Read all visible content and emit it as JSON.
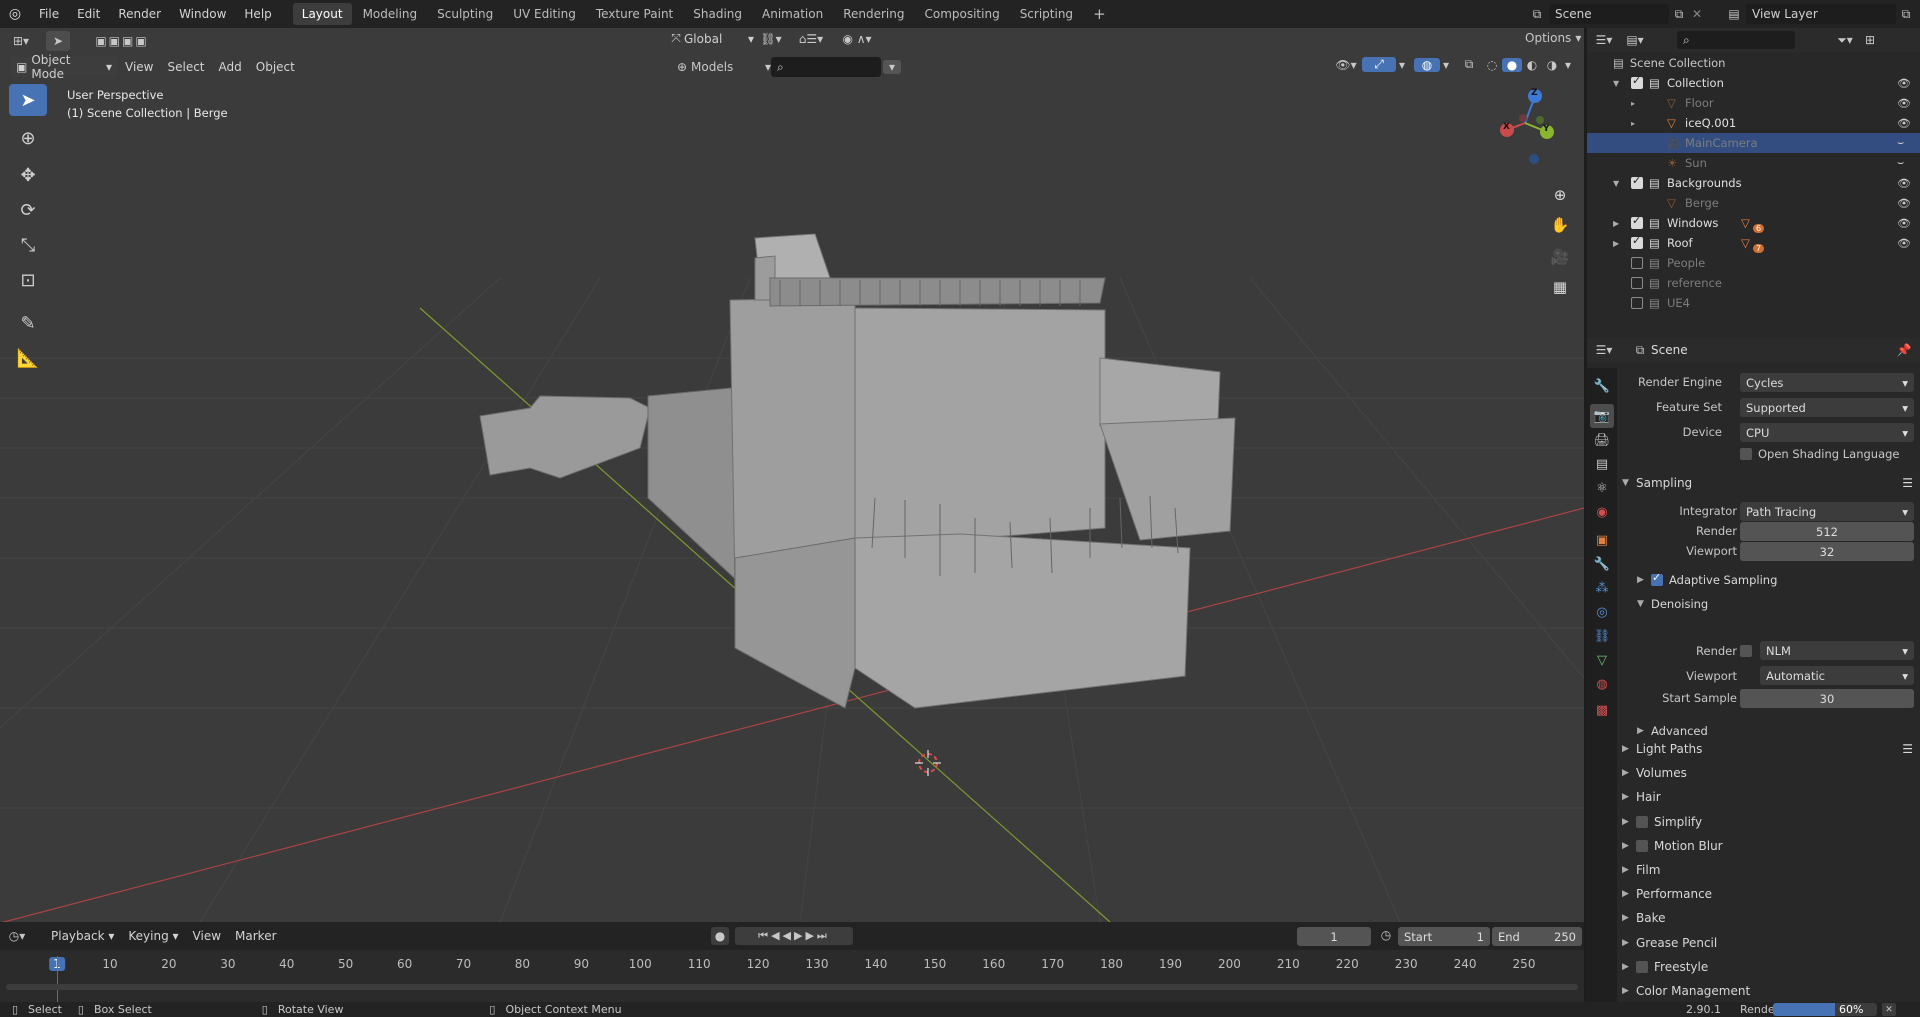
{
  "topbar": {
    "menus": [
      "File",
      "Edit",
      "Render",
      "Window",
      "Help"
    ],
    "workspaces": [
      "Layout",
      "Modeling",
      "Sculpting",
      "UV Editing",
      "Texture Paint",
      "Shading",
      "Animation",
      "Rendering",
      "Compositing",
      "Scripting"
    ],
    "add_tab": "+",
    "scene_name": "Scene",
    "view_layer": "View Layer"
  },
  "viewport": {
    "mode": "Object Mode",
    "menus": [
      "View",
      "Select",
      "Add",
      "Object"
    ],
    "transform_orientation": "Global",
    "collection_filter": "Models",
    "options": "Options",
    "overlay_title": "User Perspective",
    "overlay_subtitle": "(1) Scene Collection | Berge",
    "gizmo": {
      "x": "X",
      "y": "Y",
      "z": "Z"
    },
    "colors": {
      "bg": "#3d3d3d",
      "x_axis": "#c94a4a",
      "y_axis": "#8ab52e",
      "active_tool": "#4772b3"
    }
  },
  "timeline": {
    "menus": [
      "Playback",
      "Keying",
      "View",
      "Marker"
    ],
    "current_frame": "1",
    "start_label": "Start",
    "start": "1",
    "end_label": "End",
    "end": "250",
    "ticks": [
      "1",
      "10",
      "20",
      "30",
      "40",
      "50",
      "60",
      "70",
      "80",
      "90",
      "100",
      "110",
      "120",
      "130",
      "140",
      "150",
      "160",
      "170",
      "180",
      "190",
      "200",
      "210",
      "220",
      "230",
      "240",
      "250"
    ]
  },
  "statusbar": {
    "select": "Select",
    "box_select": "Box Select",
    "rotate_view": "Rotate View",
    "context_menu": "Object Context Menu",
    "version": "2.90.1",
    "render_label": "Render",
    "render_progress": "60%",
    "render_progress_value": 0.6
  },
  "outliner": {
    "root": "Scene Collection",
    "rows": [
      {
        "label": "Collection",
        "kind": "collection",
        "dim": false
      },
      {
        "label": "Floor",
        "kind": "object",
        "dim": true
      },
      {
        "label": "iceQ.001",
        "kind": "object",
        "dim": false
      },
      {
        "label": "MainCamera",
        "kind": "camera",
        "dim": true
      },
      {
        "label": "Sun",
        "kind": "light",
        "dim": true
      },
      {
        "label": "Backgrounds",
        "kind": "collection",
        "dim": false
      },
      {
        "label": "Berge",
        "kind": "object",
        "dim": true
      },
      {
        "label": "Windows",
        "kind": "collection",
        "dim": false,
        "badge": "6"
      },
      {
        "label": "Roof",
        "kind": "collection",
        "dim": false,
        "badge": "7"
      },
      {
        "label": "People",
        "kind": "collection",
        "dim": true
      },
      {
        "label": "reference",
        "kind": "collection",
        "dim": true
      },
      {
        "label": "UE4",
        "kind": "collection",
        "dim": true
      }
    ]
  },
  "properties": {
    "context": "Scene",
    "render_engine_label": "Render Engine",
    "render_engine": "Cycles",
    "feature_set_label": "Feature Set",
    "feature_set": "Supported",
    "device_label": "Device",
    "device": "CPU",
    "osl_label": "Open Shading Language",
    "sampling": {
      "title": "Sampling",
      "integrator_label": "Integrator",
      "integrator": "Path Tracing",
      "render_label": "Render",
      "render": "512",
      "viewport_label": "Viewport",
      "viewport": "32",
      "adaptive": "Adaptive Sampling",
      "denoising": "Denoising",
      "den_render_label": "Render",
      "den_render": "NLM",
      "den_viewport_label": "Viewport",
      "den_viewport": "Automatic",
      "start_sample_label": "Start Sample",
      "start_sample": "30",
      "advanced": "Advanced"
    },
    "panels": [
      "Light Paths",
      "Volumes",
      "Hair",
      "Simplify",
      "Motion Blur",
      "Film",
      "Performance",
      "Bake",
      "Grease Pencil",
      "Freestyle",
      "Color Management"
    ]
  }
}
